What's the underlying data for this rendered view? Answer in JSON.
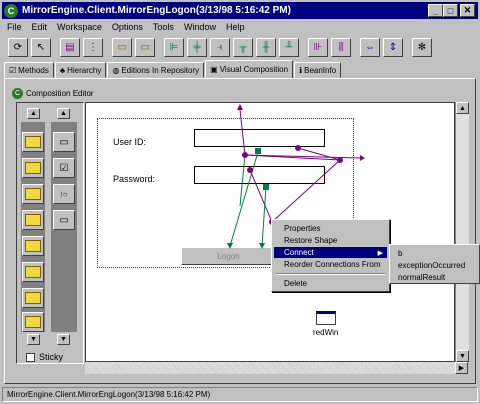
{
  "window": {
    "title": "MirrorEngine.Client.MirrorEngLogon(3/13/98 5:16:42 PM)"
  },
  "menu": [
    "File",
    "Edit",
    "Workspace",
    "Options",
    "Tools",
    "Window",
    "Help"
  ],
  "toolbar": {
    "icons": [
      "refresh-icon",
      "pointer-icon",
      "browse-icon",
      "list-icon",
      "select-icon",
      "select-all-icon",
      "align-left-icon",
      "align-center-icon",
      "align-right-icon",
      "align-top-icon",
      "align-middle-icon",
      "align-bottom-icon",
      "match-width-icon",
      "match-height-icon",
      "distribute-h-icon",
      "distribute-v-icon",
      "run-icon"
    ]
  },
  "tabs": [
    {
      "label": "Methods",
      "active": false
    },
    {
      "label": "Hierarchy",
      "active": false
    },
    {
      "label": "Editions In Repository",
      "active": false
    },
    {
      "label": "Visual Composition",
      "active": true
    },
    {
      "label": "BeanInfo",
      "active": false
    }
  ],
  "editor": {
    "label": "Composition Editor",
    "sticky_label": "Sticky",
    "form": {
      "userid_label": "User ID:",
      "password_label": "Password:",
      "logon_button": "Logon"
    },
    "redwin_label": "redWin"
  },
  "context_menu": {
    "items": [
      "Properties",
      "Restore Shape",
      "Connect",
      "Reorder Connections From",
      "Delete"
    ],
    "selected": "Connect"
  },
  "submenu": {
    "items": [
      "b",
      "exceptionOccurred",
      "normalResult"
    ]
  },
  "status": {
    "text": "MirrorEngine.Client.MirrorEngLogon(3/13/98 5:16:42 PM)"
  },
  "colors": {
    "titlebar": "#000080",
    "connection_purple": "#800080",
    "connection_green": "#008040"
  }
}
